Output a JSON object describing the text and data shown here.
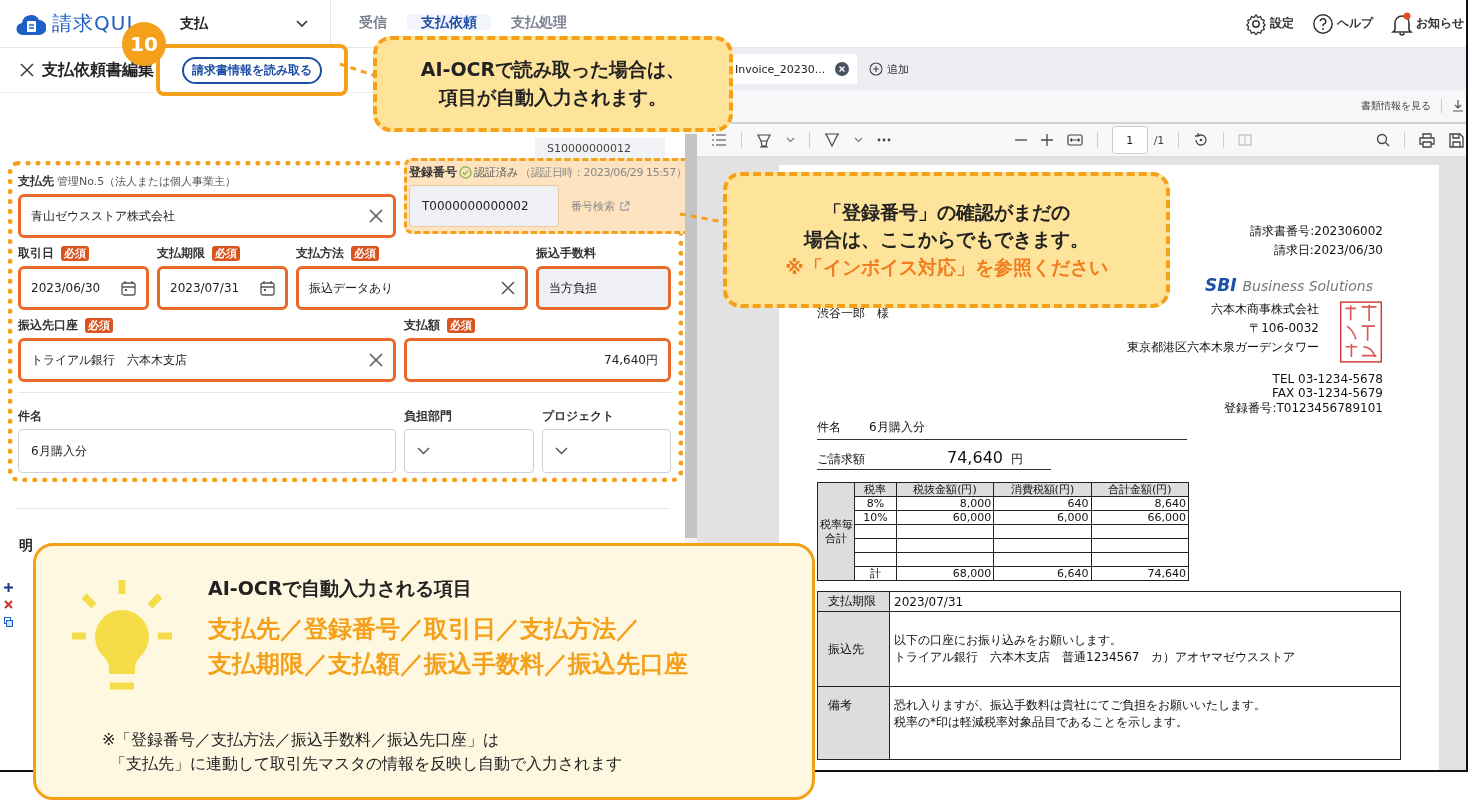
{
  "header": {
    "logo": "請求QUI",
    "menu": "支払",
    "tabs": [
      {
        "label": "受信",
        "selected": false
      },
      {
        "label": "支払依頼",
        "selected": true
      },
      {
        "label": "支払処理",
        "selected": false
      }
    ],
    "actions": [
      {
        "kind": "settings",
        "label": "設定"
      },
      {
        "kind": "help",
        "label": "ヘルプ"
      },
      {
        "kind": "notifications",
        "label": "お知らせ"
      }
    ]
  },
  "editor": {
    "title": "支払依頼書編集",
    "read_button": "請求書情報を読み取る",
    "request_no": "S10000000012",
    "rows": [
      {
        "fields": [
          {
            "kind": "clearable",
            "label": "支払先",
            "note": "管理No.5（法人または個人事業主）",
            "value": "青山ゼウスストア株式会社",
            "highlighted": true
          },
          {
            "kind": "registration",
            "label": "登録番号",
            "status": "認証済み",
            "note": "（認証日時：2023/06/29 15:57）",
            "value": "T0000000000002",
            "link": "番号検索"
          }
        ]
      },
      {
        "fields": [
          {
            "kind": "date",
            "label": "取引日",
            "badge": "必須",
            "value": "2023/06/30",
            "highlighted": true
          },
          {
            "kind": "date",
            "label": "支払期限",
            "badge": "必須",
            "value": "2023/07/31",
            "highlighted": true
          },
          {
            "kind": "clearable",
            "label": "支払方法",
            "badge": "必須",
            "value": "振込データあり",
            "highlighted": true
          },
          {
            "kind": "readonly",
            "label": "振込手数料",
            "value": "当方負担",
            "highlighted": true
          }
        ]
      },
      {
        "fields": [
          {
            "kind": "clearable",
            "label": "振込先口座",
            "badge": "必須",
            "value": "トライアル銀行　六本木支店",
            "highlighted": true
          },
          {
            "kind": "amount",
            "label": "支払額",
            "badge": "必須",
            "value": "74,640円",
            "highlighted": true
          }
        ]
      },
      {
        "fields": [
          {
            "kind": "text",
            "label": "件名",
            "value": "6月購入分",
            "highlighted": false
          },
          {
            "kind": "select",
            "label": "負担部門",
            "highlighted": false
          },
          {
            "kind": "select",
            "label": "プロジェクト",
            "highlighted": false
          }
        ]
      }
    ],
    "section": "明"
  },
  "viewer": {
    "tab": "Invoice_20230...",
    "add": "追加",
    "info_link": "書類情報を見る",
    "page": "1",
    "page_total": "/1",
    "document": {
      "invoice_no": "請求書番号:202306002",
      "date": "請求日:2023/06/30",
      "logo_mark": "SBI",
      "logo_text": "Business Solutions",
      "recipient": "渋谷一郎　様",
      "company": "六本木商事株式会社",
      "postal": "〒106-0032",
      "address": "東京都港区六本木泉ガーデンタワー",
      "contact": [
        "TEL 03-1234-5678",
        "FAX 03-1234-5679",
        "登録番号:T0123456789101"
      ],
      "subject_label": "件名",
      "subject": "6月購入分",
      "total_label": "ご請求額",
      "total": "74,640",
      "currency": "円",
      "tax_side": "税率毎合計",
      "tax_columns": [
        "税率",
        "税抜金額(円)",
        "消費税額(円)",
        "合計金額(円)"
      ],
      "tax_rows": [
        {
          "kind": "values",
          "cells": [
            "8%",
            "8,000",
            "640",
            "8,640"
          ]
        },
        {
          "kind": "values",
          "cells": [
            "10%",
            "60,000",
            "6,000",
            "66,000"
          ]
        },
        {
          "kind": "blank"
        },
        {
          "kind": "blank"
        },
        {
          "kind": "blank"
        },
        {
          "kind": "values",
          "cells": [
            "計",
            "68,000",
            "6,640",
            "74,640"
          ]
        }
      ],
      "footer_rows": [
        {
          "label": "支払期限",
          "lines": [
            "2023/07/31"
          ]
        },
        {
          "label": "振込先",
          "lines": [
            "以下の口座にお振り込みをお願いします。",
            "トライアル銀行　六本木支店　普通1234567　カ）アオヤマゼウスストア"
          ]
        },
        {
          "label": "備考",
          "lines": [
            "恐れ入りますが、振込手数料は貴社にてご負担をお願いいたします。",
            "税率の*印は軽減税率対象品目であることを示します。"
          ]
        }
      ]
    }
  },
  "step_badge": "10",
  "callouts": [
    {
      "lines": [
        {
          "text": "AI-OCRで読み取った場合は、",
          "emphasis": false
        },
        {
          "text": "項目が自動入力されます。",
          "emphasis": false
        }
      ]
    },
    {
      "lines": [
        {
          "text": "「登録番号」の確認がまだの",
          "emphasis": false
        },
        {
          "text": "場合は、ここからでもできます。",
          "emphasis": false
        },
        {
          "text": "※「インボイス対応」を参照ください",
          "emphasis": true
        }
      ]
    }
  ],
  "tip": {
    "title": "AI-OCRで自動入力される項目",
    "items": [
      "支払先／登録番号／取引日／支払方法／",
      "支払期限／支払額／振込手数料／振込先口座"
    ],
    "note": [
      "※「登録番号／支払方法／振込手数料／振込先口座」は",
      "「支払先」に連動して取引先マスタの情報を反映し自動で入力されます"
    ]
  }
}
